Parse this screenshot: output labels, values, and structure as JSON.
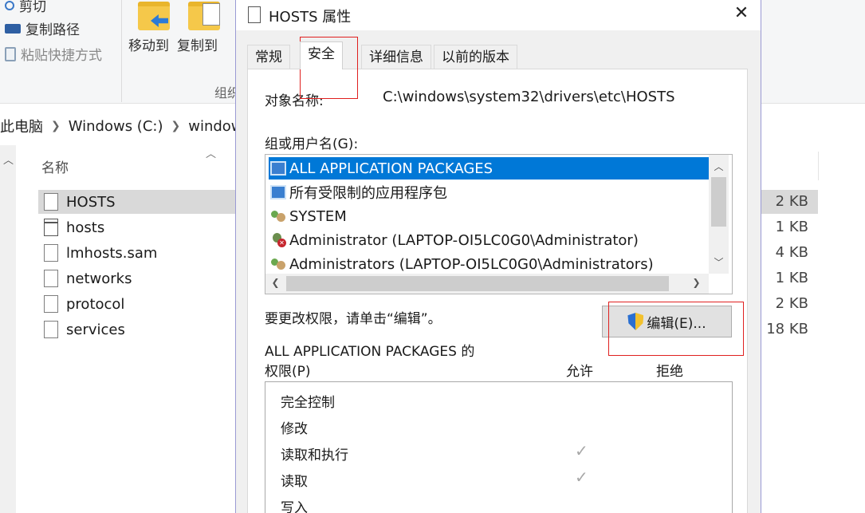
{
  "explorer": {
    "ribbon": {
      "cut_label": "剪切",
      "copy_path_label": "复制路径",
      "paste_shortcut_label": "粘贴快捷方式",
      "move_to_label": "移动到",
      "copy_to_label": "复制到",
      "group_label": "组织"
    },
    "breadcrumb": [
      "此电脑",
      "Windows (C:)",
      "windows"
    ],
    "column_name": "名称",
    "files": [
      {
        "name": "HOSTS",
        "size": "2 KB"
      },
      {
        "name": "hosts",
        "size": "1 KB"
      },
      {
        "name": "lmhosts.sam",
        "size": "4 KB"
      },
      {
        "name": "networks",
        "size": "1 KB"
      },
      {
        "name": "protocol",
        "size": "2 KB"
      },
      {
        "name": "services",
        "size": "18 KB"
      }
    ],
    "selected_file_index": 0
  },
  "dialog": {
    "title": "HOSTS 属性",
    "tabs": [
      "常规",
      "安全",
      "详细信息",
      "以前的版本"
    ],
    "active_tab": "安全",
    "object_name_label": "对象名称:",
    "object_name_value": "C:\\windows\\system32\\drivers\\etc\\HOSTS",
    "groups_label": "组或用户名(G):",
    "groups": [
      {
        "name": "ALL APPLICATION PACKAGES",
        "icon": "package-icon",
        "selected": true
      },
      {
        "name": "所有受限制的应用程序包",
        "icon": "package-icon",
        "selected": false
      },
      {
        "name": "SYSTEM",
        "icon": "group-icon",
        "selected": false
      },
      {
        "name": "Administrator (LAPTOP-OI5LC0G0\\Administrator)",
        "icon": "admin-user-icon",
        "selected": false
      },
      {
        "name": "Administrators (LAPTOP-OI5LC0G0\\Administrators)",
        "icon": "group-icon",
        "selected": false
      }
    ],
    "change_hint": "要更改权限，请单击“编辑”。",
    "edit_button_label": "编辑(E)...",
    "permissions_title": "ALL APPLICATION PACKAGES 的",
    "permissions_label": "权限(P)",
    "allow_header": "允许",
    "deny_header": "拒绝",
    "permissions": [
      {
        "name": "完全控制",
        "allow": false,
        "deny": false
      },
      {
        "name": "修改",
        "allow": false,
        "deny": false
      },
      {
        "name": "读取和执行",
        "allow": true,
        "deny": false
      },
      {
        "name": "读取",
        "allow": true,
        "deny": false
      },
      {
        "name": "写入",
        "allow": false,
        "deny": false
      }
    ]
  },
  "colors": {
    "selection_blue": "#0078d7",
    "annotation_red": "#e0201f",
    "dialog_border": "#9a9ad4"
  }
}
